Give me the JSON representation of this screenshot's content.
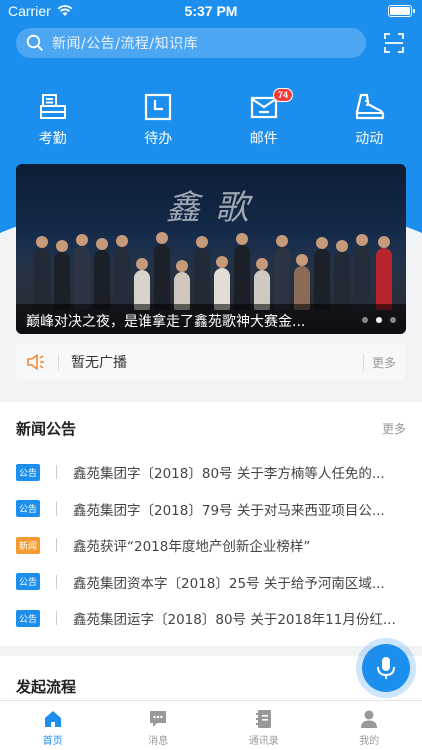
{
  "status_bar": {
    "carrier": "Carrier",
    "time": "5:37 PM"
  },
  "search": {
    "placeholder": "新闻/公告/流程/知识库"
  },
  "quick_actions": [
    {
      "label": "考勤",
      "icon": "attendance-icon"
    },
    {
      "label": "待办",
      "icon": "todo-icon"
    },
    {
      "label": "邮件",
      "icon": "mail-icon",
      "badge": "74"
    },
    {
      "label": "动动",
      "icon": "sneaker-icon"
    }
  ],
  "banner": {
    "title_art": "鑫 歌",
    "caption": "巅峰对决之夜，是谁拿走了鑫苑歌神大赛金...",
    "dots": 3,
    "active_dot": 2
  },
  "broadcast": {
    "text": "暂无广播",
    "more": "更多"
  },
  "news": {
    "title": "新闻公告",
    "more": "更多",
    "items": [
      {
        "tag": "公告",
        "type": "gg",
        "text": "鑫苑集团字〔2018〕80号 关于李方楠等人任免的..."
      },
      {
        "tag": "公告",
        "type": "gg",
        "text": "鑫苑集团字〔2018〕79号 关于对马来西亚项目公..."
      },
      {
        "tag": "新闻",
        "type": "xw",
        "text": "鑫苑获评“2018年度地产创新企业榜样”"
      },
      {
        "tag": "公告",
        "type": "gg",
        "text": "鑫苑集团资本字〔2018〕25号 关于给予河南区域..."
      },
      {
        "tag": "公告",
        "type": "gg",
        "text": "鑫苑集团运字〔2018〕80号 关于2018年11月份红..."
      }
    ]
  },
  "flow": {
    "title": "发起流程"
  },
  "tabs": [
    {
      "label": "首页",
      "icon": "home-icon",
      "active": true
    },
    {
      "label": "消息",
      "icon": "message-icon",
      "active": false
    },
    {
      "label": "通讯录",
      "icon": "contacts-icon",
      "active": false
    },
    {
      "label": "我的",
      "icon": "profile-icon",
      "active": false
    }
  ],
  "colors": {
    "brand_blue": "#1c8eee",
    "badge_red": "#f23c3c",
    "news_orange": "#f39c33"
  }
}
